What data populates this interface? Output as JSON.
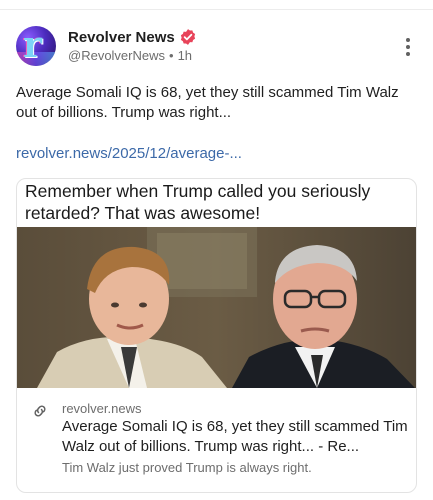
{
  "author": {
    "name": "Revolver News",
    "handle": "@RevolverNews",
    "separator": "•",
    "time": "1h",
    "avatar_icon": "revolver-logo-icon",
    "verified_icon": "verified-badge-icon",
    "verified_color": "#e8445a"
  },
  "post": {
    "text": "Average Somali IQ is 68, yet they still scammed Tim Walz out of billions. Trump was right...",
    "link_text": "revolver.news/2025/12/average-..."
  },
  "card": {
    "headline": "Remember when Trump called you seriously retarded? That was awesome!",
    "domain": "revolver.news",
    "title": "Average Somali IQ is 68, yet they still scammed Tim Walz out of billions. Trump was right... - Re...",
    "description": "Tim Walz just proved Trump is always right.",
    "link_icon": "link-icon"
  },
  "menu": {
    "icon": "more-vertical-icon"
  },
  "colors": {
    "link": "#3c69a8",
    "muted": "#6d6d6d",
    "text": "#1f1f1f",
    "border": "#e3e3e3"
  }
}
